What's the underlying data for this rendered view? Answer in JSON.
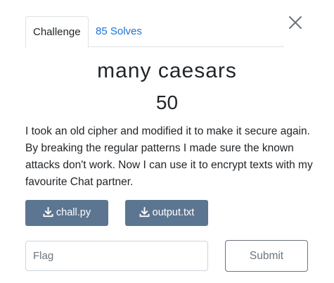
{
  "modal": {
    "close_icon": "close-icon",
    "tabs": [
      {
        "label": "Challenge",
        "active": true
      },
      {
        "label": "85 Solves",
        "active": false
      }
    ],
    "challenge": {
      "name": "many caesars",
      "value": "50",
      "description": "I took an old cipher and modified it to make it secure again. By breaking the regular patterns I made sure the known attacks don't work. Now I can use it to encrypt texts with my favourite Chat partner."
    },
    "files": [
      {
        "label": "chall.py",
        "icon": "download-icon"
      },
      {
        "label": "output.txt",
        "icon": "download-icon"
      }
    ],
    "flag_input": {
      "placeholder": "Flag",
      "value": ""
    },
    "submit_label": "Submit"
  },
  "colors": {
    "file_button_bg": "#5c7591",
    "link_blue": "#1e73d8",
    "text": "#212529",
    "muted": "#6c757d"
  }
}
